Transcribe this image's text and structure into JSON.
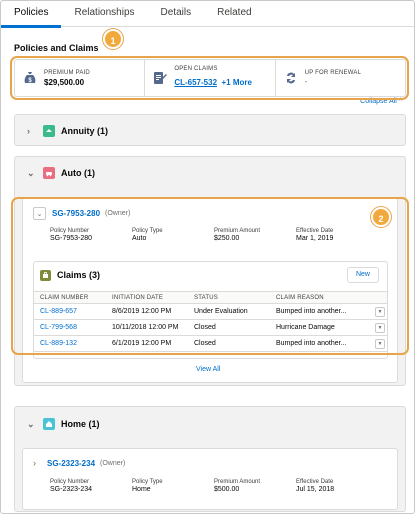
{
  "tabs": [
    {
      "label": "Policies",
      "active": true
    },
    {
      "label": "Relationships",
      "active": false
    },
    {
      "label": "Details",
      "active": false
    },
    {
      "label": "Related",
      "active": false
    }
  ],
  "section_title": "Policies and Claims",
  "summary": {
    "premium": {
      "label": "PREMIUM PAID",
      "value": "$29,500.00",
      "icon": "money-bag-icon"
    },
    "open_claims": {
      "label": "OPEN CLAIMS",
      "value": "CL-657-532",
      "more": "+1 More",
      "icon": "claim-document-icon"
    },
    "renewal": {
      "label": "UP FOR RENEWAL",
      "value": "-",
      "icon": "renewal-arrows-icon"
    }
  },
  "collapse_all": "Collapse All",
  "callouts": {
    "one": "1",
    "two": "2"
  },
  "groups": {
    "annuity": {
      "label": "Annuity (1)",
      "icon_color": "#3bba8c"
    },
    "auto": {
      "label": "Auto (1)",
      "icon_color": "#e96e82"
    },
    "home": {
      "label": "Home (1)",
      "icon_color": "#4bc3d6"
    }
  },
  "auto_policy": {
    "number": "SG-7953-280",
    "owner": "(Owner)",
    "fields": [
      {
        "label": "Policy Number",
        "value": "SG-7953-280"
      },
      {
        "label": "Policy Type",
        "value": "Auto"
      },
      {
        "label": "Premium Amount",
        "value": "$250.00"
      },
      {
        "label": "Effective Date",
        "value": "Mar 1, 2019"
      }
    ]
  },
  "claims": {
    "title": "Claims (3)",
    "new_label": "New",
    "columns": [
      "CLAIM NUMBER",
      "INITIATION DATE",
      "STATUS",
      "CLAIM REASON"
    ],
    "rows": [
      {
        "number": "CL-889-657",
        "date": "8/6/2019 12:00 PM",
        "status": "Under Evaluation",
        "reason": "Bumped into another..."
      },
      {
        "number": "CL-799-568",
        "date": "10/11/2018 12:00 PM",
        "status": "Closed",
        "reason": "Hurricane Damage"
      },
      {
        "number": "CL-889-132",
        "date": "6/1/2019 12:00 PM",
        "status": "Closed",
        "reason": "Bumped into another..."
      }
    ]
  },
  "view_all": "View All",
  "home_policy": {
    "number": "SG-2323-234",
    "owner": "(Owner)",
    "fields": [
      {
        "label": "Policy Number",
        "value": "SG-2323-234"
      },
      {
        "label": "Policy Type",
        "value": "Home"
      },
      {
        "label": "Premium Amount",
        "value": "$500.00"
      },
      {
        "label": "Effective Date",
        "value": "Jul 15, 2018"
      }
    ]
  }
}
